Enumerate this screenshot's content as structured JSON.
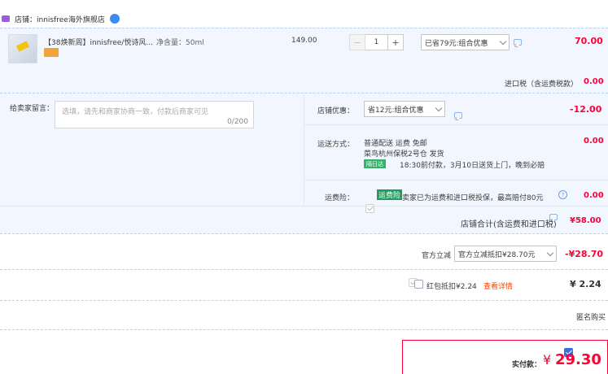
{
  "shop": {
    "name": "店铺：innisfree海外旗舰店"
  },
  "item": {
    "title": "【38焕新周】innisfree/悦诗风...",
    "spec": "净含量：50ml",
    "unit_price": "149.00",
    "qty": "1",
    "minus": "−",
    "plus": "+",
    "promo_select": "已省79元:组合优惠",
    "total": "70.00"
  },
  "import_tax": {
    "label": "进口税（含运费税款）",
    "value": "0.00"
  },
  "message": {
    "label": "给卖家留言：",
    "placeholder": "选填，请先和商家协商一致，付款后商家可见",
    "counter": "0/200"
  },
  "shop_discount": {
    "label": "店铺优惠：",
    "select": "省12元:组合优惠",
    "value": "-12.00"
  },
  "shipping": {
    "label": "运送方式：",
    "line1": "普通配送 运费 免邮",
    "line2": "菜鸟杭州保税2号仓  发货",
    "badge": "隔日达",
    "line3": "18:30前付款，3月10日送货上门，晚到必赔",
    "value": "0.00"
  },
  "insurance": {
    "label": "运费险：",
    "tag": "运费险",
    "text": "卖家已为运费和进口税投保，最高赔付80元",
    "help": "?",
    "value": "0.00"
  },
  "shop_total": {
    "label": "店铺合计(含运费和进口税)",
    "value": "¥58.00"
  },
  "official_discount": {
    "label": "官方立减",
    "select": "官方立减抵扣¥28.70元",
    "value": "-¥28.70"
  },
  "redpacket": {
    "label": "红包抵扣¥2.24",
    "link": "查看详情",
    "value": "¥ 2.24"
  },
  "anonymous": {
    "label": "匿名购买"
  },
  "payment": {
    "label": "实付款：",
    "currency": "¥",
    "value": "29.30"
  },
  "colors": {
    "accent_red": "#ff0036",
    "link_orange": "#f40",
    "blue_bg": "#f2f7ff",
    "dashed_blue": "#b2d1ff"
  }
}
